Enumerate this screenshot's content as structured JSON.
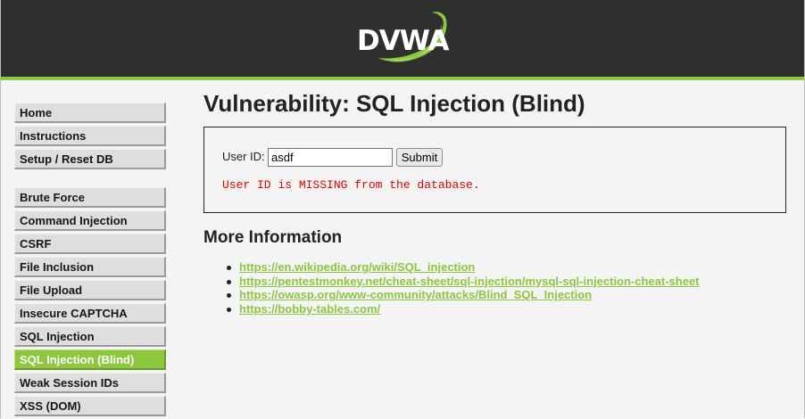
{
  "header": {
    "logo_text": "DVWA",
    "accent_color": "#8dc63f"
  },
  "sidebar": {
    "group1": [
      {
        "label": "Home"
      },
      {
        "label": "Instructions"
      },
      {
        "label": "Setup / Reset DB"
      }
    ],
    "group2": [
      {
        "label": "Brute Force"
      },
      {
        "label": "Command Injection"
      },
      {
        "label": "CSRF"
      },
      {
        "label": "File Inclusion"
      },
      {
        "label": "File Upload"
      },
      {
        "label": "Insecure CAPTCHA"
      },
      {
        "label": "SQL Injection"
      },
      {
        "label": "SQL Injection (Blind)",
        "selected": true
      },
      {
        "label": "Weak Session IDs"
      },
      {
        "label": "XSS (DOM)"
      }
    ]
  },
  "main": {
    "title": "Vulnerability: SQL Injection (Blind)",
    "form": {
      "user_id_label": "User ID:",
      "user_id_value": "asdf",
      "submit_label": "Submit"
    },
    "error_message": "User ID is MISSING from the database.",
    "more_info_title": "More Information",
    "links": [
      "https://en.wikipedia.org/wiki/SQL_injection",
      "https://pentestmonkey.net/cheat-sheet/sql-injection/mysql-sql-injection-cheat-sheet",
      "https://owasp.org/www-community/attacks/Blind_SQL_Injection",
      "https://bobby-tables.com/"
    ]
  },
  "colors": {
    "header_bg": "#2f2f2f",
    "error": "#e00000",
    "link": "#8dc63f"
  }
}
